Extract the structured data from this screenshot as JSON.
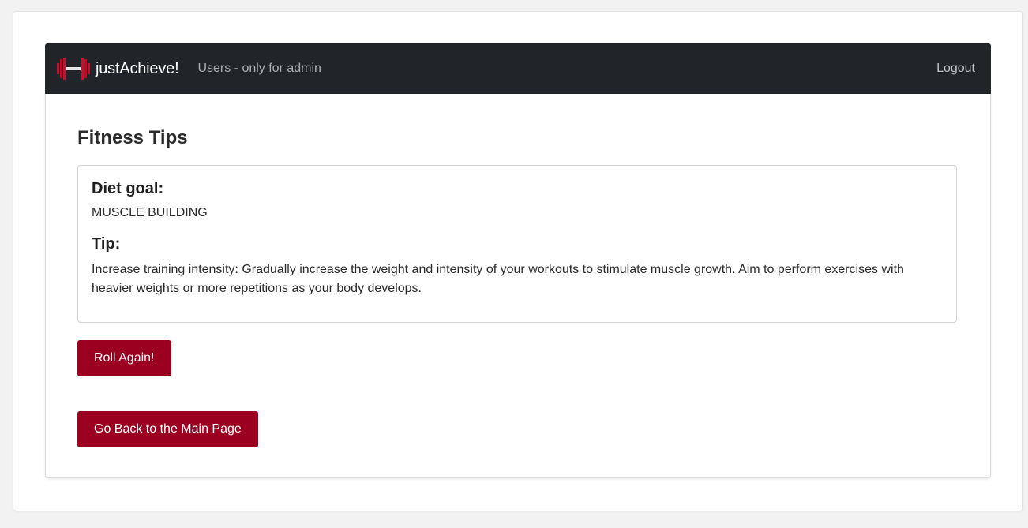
{
  "navbar": {
    "brand": "justAchieve!",
    "users_link": "Users - only for admin",
    "logout": "Logout",
    "logo_icon": "dumbbell-icon"
  },
  "main": {
    "title": "Fitness Tips",
    "diet_goal_label": "Diet goal:",
    "diet_goal_value": "MUSCLE BUILDING",
    "tip_label": "Tip:",
    "tip_text": "Increase training intensity: Gradually increase the weight and intensity of your workouts to stimulate muscle growth. Aim to perform exercises with heavier weights or more repetitions as your body develops.",
    "roll_button": "Roll Again!",
    "back_button": "Go Back to the Main Page"
  },
  "colors": {
    "navbar_bg": "#212529",
    "button_bg": "#9b0020",
    "page_bg": "#f2f2f2"
  }
}
